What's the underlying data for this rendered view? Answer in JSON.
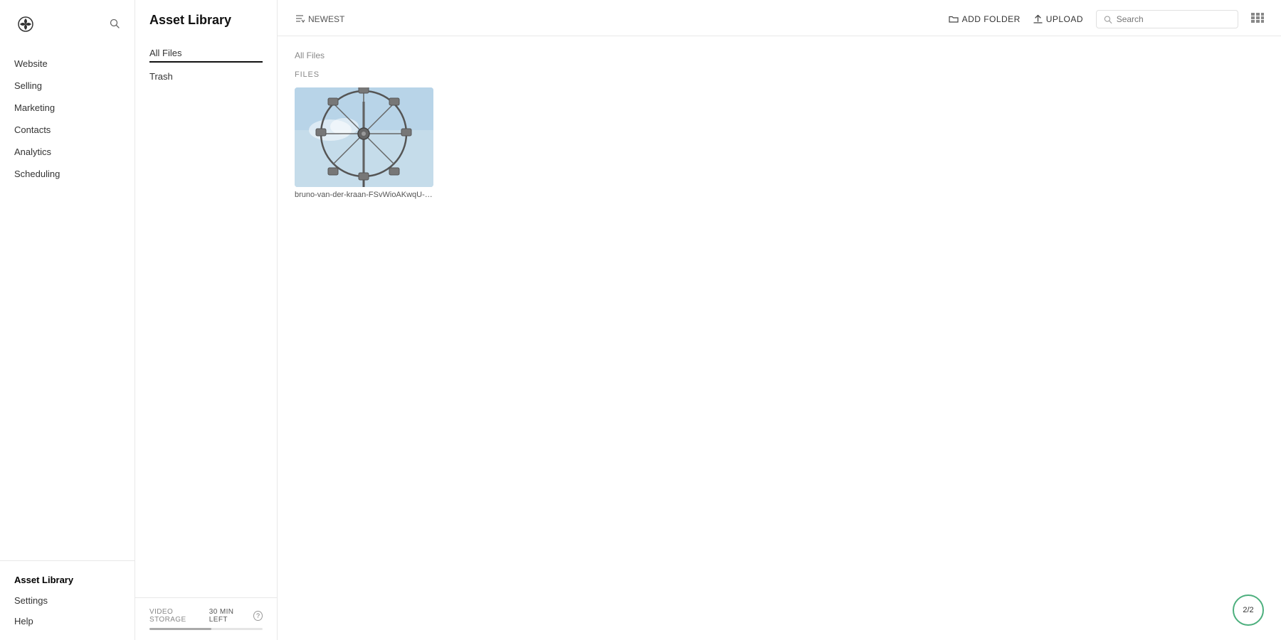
{
  "sidebar": {
    "logo_alt": "Squarespace logo",
    "nav_items": [
      {
        "label": "Website",
        "id": "website"
      },
      {
        "label": "Selling",
        "id": "selling"
      },
      {
        "label": "Marketing",
        "id": "marketing"
      },
      {
        "label": "Contacts",
        "id": "contacts"
      },
      {
        "label": "Analytics",
        "id": "analytics"
      },
      {
        "label": "Scheduling",
        "id": "scheduling"
      }
    ],
    "bottom_items": [
      {
        "label": "Asset Library",
        "id": "asset-library",
        "active": true
      },
      {
        "label": "Settings",
        "id": "settings",
        "active": false
      },
      {
        "label": "Help",
        "id": "help",
        "active": false
      }
    ]
  },
  "second_panel": {
    "title": "Asset Library",
    "nav_items": [
      {
        "label": "All Files",
        "id": "all-files",
        "active": true
      },
      {
        "label": "Trash",
        "id": "trash",
        "active": false
      }
    ],
    "footer": {
      "storage_label": "VIDEO STORAGE",
      "storage_time": "30 MIN LEFT",
      "help_tooltip": "?"
    }
  },
  "toolbar": {
    "sort_label": "NEWEST",
    "search_placeholder": "Search",
    "add_folder_label": "ADD FOLDER",
    "upload_label": "UPLOAD"
  },
  "main": {
    "breadcrumb": "All Files",
    "section_label": "FILES",
    "files": [
      {
        "id": "file-1",
        "name": "bruno-van-der-kraan-FSvWioAKwqU-unsplas...",
        "type": "image"
      }
    ]
  },
  "badge": {
    "text": "2/2"
  },
  "icons": {
    "logo": "✦",
    "search": "🔍",
    "sort_down": "↓",
    "folder": "📁",
    "upload": "⬆",
    "grid_view": "☰",
    "search_small": "⌕"
  }
}
